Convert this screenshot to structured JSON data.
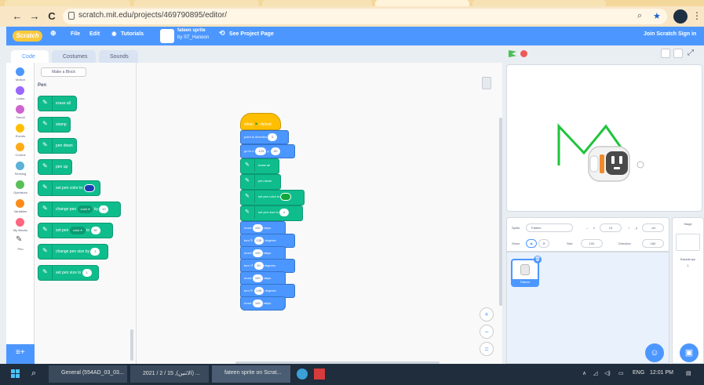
{
  "browser": {
    "url": "scratch.mit.edu/projects/469790895/editor/",
    "back": "←",
    "forward": "→",
    "reload": "C"
  },
  "menubar": {
    "logo": "Scratch",
    "file": "File",
    "edit": "Edit",
    "tutorials": "Tutorials",
    "project_title_line1": "fateen sprite",
    "project_title_line2": "by ST_Hanoon",
    "see_project": "See Project Page",
    "join": "Join Scratch",
    "signin": "Sign in"
  },
  "editor_tabs": {
    "code": "Code",
    "costumes": "Costumes",
    "sounds": "Sounds"
  },
  "categories": [
    {
      "label": "Motion",
      "color": "#4c97ff"
    },
    {
      "label": "Looks",
      "color": "#9966ff"
    },
    {
      "label": "Sound",
      "color": "#cf63cf"
    },
    {
      "label": "Events",
      "color": "#ffbf00"
    },
    {
      "label": "Control",
      "color": "#ffab19"
    },
    {
      "label": "Sensing",
      "color": "#5cb1d6"
    },
    {
      "label": "Operators",
      "color": "#59c059"
    },
    {
      "label": "Variables",
      "color": "#ff8c1a"
    },
    {
      "label": "My Blocks",
      "color": "#ff6680"
    },
    {
      "label": "Pen",
      "color": "#0fbd8c"
    }
  ],
  "palette": {
    "make_block": "Make a Block",
    "section": "Pen",
    "blocks": {
      "erase_all": "erase all",
      "stamp": "stamp",
      "pen_down": "pen down",
      "pen_up": "pen up",
      "set_color_to": "set pen color to",
      "change_pen": "change pen",
      "by": "by",
      "color_option": "color",
      "change_value": "10",
      "set_pen": "set pen",
      "to": "to",
      "set_value": "50",
      "change_size": "change pen size by",
      "change_size_value": "1",
      "set_size": "set pen size to",
      "set_size_value": "1"
    },
    "pen_color_swatch": "#1e3cb4"
  },
  "script": {
    "hat": "when",
    "hat_suffix": "clicked",
    "point_label": "point in direction",
    "point_value": "0",
    "goto_label": "go to x:",
    "goto_x": "-123",
    "goto_y_label": "y:",
    "goto_y": "-50",
    "erase_all": "erase all",
    "pen_down": "pen down",
    "set_color": "set pen color to",
    "set_color_swatch": "#0fa83c",
    "set_size": "set pen size to",
    "set_size_value": "4",
    "move1": {
      "label": "move",
      "value": "100",
      "suffix": "steps"
    },
    "turn1": {
      "label": "turn",
      "value": "135",
      "suffix": "degrees"
    },
    "move2": {
      "label": "move",
      "value": "100",
      "suffix": "steps"
    },
    "turn2": {
      "label": "turn",
      "value": "90",
      "suffix": "degrees"
    },
    "move3": {
      "label": "move",
      "value": "100",
      "suffix": "steps"
    },
    "turn3": {
      "label": "turn",
      "value": "135",
      "suffix": "degrees"
    },
    "move4": {
      "label": "move",
      "value": "100",
      "suffix": "steps"
    }
  },
  "zoom": {
    "in": "+",
    "out": "−",
    "reset": "="
  },
  "sprite_info": {
    "sprite_label": "Sprite",
    "sprite_name": "Fateen",
    "x_label": "x",
    "x_value": "13",
    "y_label": "y",
    "y_value": "-44",
    "show_label": "Show",
    "size_label": "Size",
    "size_value": "100",
    "direction_label": "Direction",
    "direction_value": "180"
  },
  "sprite_card_name": "Fateen",
  "stage_panel": {
    "title": "Stage",
    "backdrops": "Backdrops",
    "count": "1"
  },
  "taskbar": {
    "item1": "General (554AD_03_03...",
    "item2": "2021 / 2 / 15 ,(الاثنين) ...",
    "item3": "fateen sprite on Scrat...",
    "lang": "ENG",
    "time": "12:01 PM"
  }
}
